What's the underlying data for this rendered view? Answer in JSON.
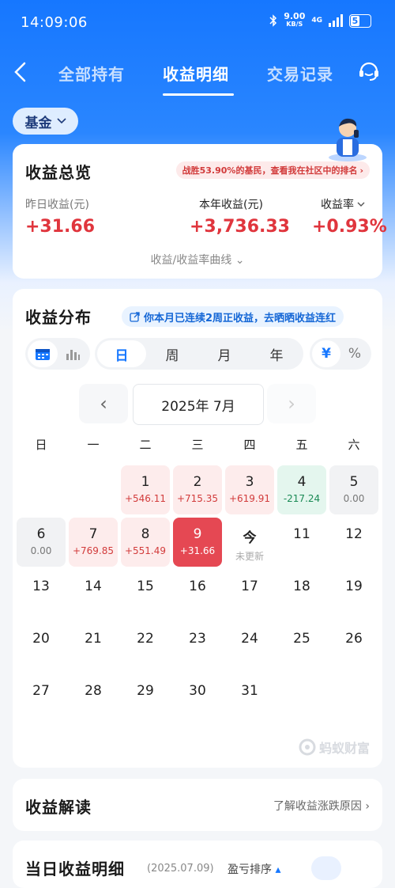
{
  "status": {
    "time": "14:09:06",
    "net_speed": "9.00",
    "net_unit": "KB/S",
    "net_type": "4G",
    "battery": "5"
  },
  "nav": {
    "tabs": [
      "全部持有",
      "收益明细",
      "交易记录"
    ],
    "active_index": 1
  },
  "filter": {
    "label": "基金"
  },
  "overview": {
    "title": "收益总览",
    "rank_text": "战胜53.90%的基民，查看我在社区中的排名",
    "yesterday_label": "昨日收益(元)",
    "yesterday_value": "+31.66",
    "year_label": "本年收益(元)",
    "year_value": "+3,736.33",
    "rate_label": "收益率",
    "rate_value": "+0.93%",
    "curve_link": "收益/收益率曲线"
  },
  "distribution": {
    "title": "收益分布",
    "badge": "你本月已连续2周正收益，去晒晒收益连红",
    "period_tabs": [
      "日",
      "周",
      "月",
      "年"
    ],
    "active_period": 0,
    "unit_tabs": [
      "¥",
      "%"
    ],
    "active_unit": 0,
    "month_label": "2025年 7月",
    "weekdays": [
      "日",
      "一",
      "二",
      "三",
      "四",
      "五",
      "六"
    ],
    "days": [
      {
        "n": "1",
        "v": "+546.11",
        "state": "up"
      },
      {
        "n": "2",
        "v": "+715.35",
        "state": "up"
      },
      {
        "n": "3",
        "v": "+619.91",
        "state": "up"
      },
      {
        "n": "4",
        "v": "-217.24",
        "state": "down"
      },
      {
        "n": "5",
        "v": "0.00",
        "state": "zero"
      },
      {
        "n": "6",
        "v": "0.00",
        "state": "zero"
      },
      {
        "n": "7",
        "v": "+769.85",
        "state": "up"
      },
      {
        "n": "8",
        "v": "+551.49",
        "state": "up"
      },
      {
        "n": "9",
        "v": "+31.66",
        "state": "sel"
      },
      {
        "n": "今",
        "v": "未更新",
        "state": "today"
      },
      {
        "n": "11",
        "v": "",
        "state": "none"
      },
      {
        "n": "12",
        "v": "",
        "state": "none"
      },
      {
        "n": "13",
        "v": "",
        "state": "none"
      },
      {
        "n": "14",
        "v": "",
        "state": "none"
      },
      {
        "n": "15",
        "v": "",
        "state": "none"
      },
      {
        "n": "16",
        "v": "",
        "state": "none"
      },
      {
        "n": "17",
        "v": "",
        "state": "none"
      },
      {
        "n": "18",
        "v": "",
        "state": "none"
      },
      {
        "n": "19",
        "v": "",
        "state": "none"
      },
      {
        "n": "20",
        "v": "",
        "state": "none"
      },
      {
        "n": "21",
        "v": "",
        "state": "none"
      },
      {
        "n": "22",
        "v": "",
        "state": "none"
      },
      {
        "n": "23",
        "v": "",
        "state": "none"
      },
      {
        "n": "24",
        "v": "",
        "state": "none"
      },
      {
        "n": "25",
        "v": "",
        "state": "none"
      },
      {
        "n": "26",
        "v": "",
        "state": "none"
      },
      {
        "n": "27",
        "v": "",
        "state": "none"
      },
      {
        "n": "28",
        "v": "",
        "state": "none"
      },
      {
        "n": "29",
        "v": "",
        "state": "none"
      },
      {
        "n": "30",
        "v": "",
        "state": "none"
      },
      {
        "n": "31",
        "v": "",
        "state": "none"
      }
    ],
    "brand": "蚂蚁财富"
  },
  "interpret": {
    "title": "收益解读",
    "link": "了解收益涨跌原因"
  },
  "detail": {
    "title": "当日收益明细",
    "date": "(2025.07.09)",
    "sort": "盈亏排序"
  },
  "colors": {
    "primary": "#1677ff",
    "gain": "#e0353d",
    "loss": "#1a8a55"
  }
}
